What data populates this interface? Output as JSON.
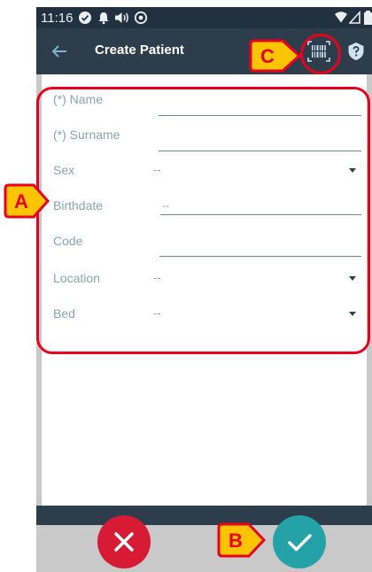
{
  "status_bar": {
    "time": "11:16",
    "icons": [
      "check-circle-icon",
      "notification-bell-icon",
      "volume-icon",
      "sync-icon",
      "wifi-icon",
      "signal-icon",
      "battery-icon"
    ]
  },
  "app_bar": {
    "title": "Create Patient",
    "icons": [
      "back-arrow-icon",
      "barcode-scan-icon",
      "help-icon"
    ]
  },
  "form": {
    "name": {
      "label": "(*) Name"
    },
    "surname": {
      "label": "(*) Surname"
    },
    "sex": {
      "label": "Sex",
      "value": "--"
    },
    "birthdate": {
      "label": "Birthdate",
      "value": "--"
    },
    "code": {
      "label": "Code"
    },
    "location": {
      "label": "Location",
      "value": "--"
    },
    "bed": {
      "label": "Bed",
      "value": "--"
    }
  },
  "actions": {
    "cancel_icon": "close-icon",
    "confirm_icon": "checkmark-icon"
  },
  "callouts": {
    "a": "A",
    "b": "B",
    "c": "C"
  },
  "colors": {
    "header": "#2e3d4b",
    "status_bar": "#22313f",
    "label": "#8aa3b3",
    "underline": "#6e8796",
    "cancel": "#d81b34",
    "confirm": "#25a1a8",
    "callout_red": "#e8001e",
    "callout_fill": "#ffc400"
  }
}
